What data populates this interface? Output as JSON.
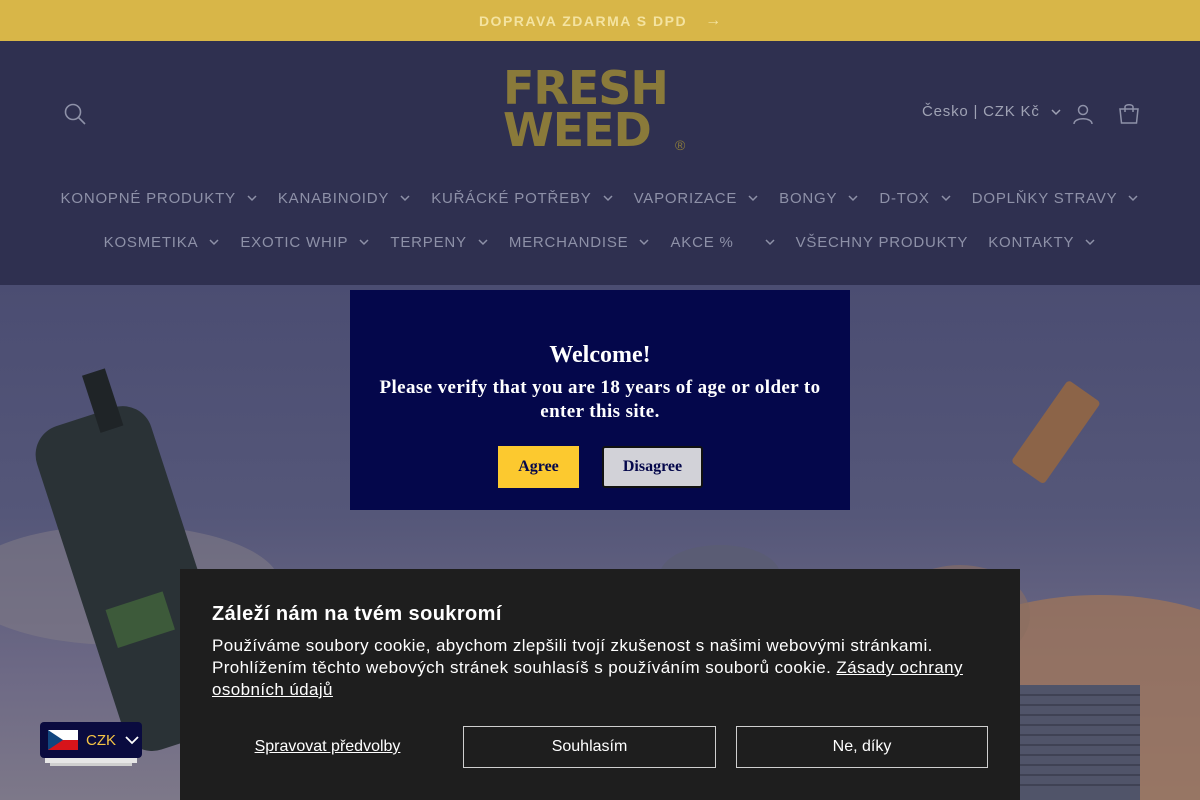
{
  "announcement": {
    "text": "DOPRAVA ZDARMA S DPD",
    "arrow": "→"
  },
  "header": {
    "logo_line1": "FRESH",
    "logo_line2": "WEED",
    "logo_reg": "®",
    "locale_label": "Česko | CZK Kč"
  },
  "nav": {
    "row1": [
      "KONOPNÉ PRODUKTY",
      "KANABINOIDY",
      "KUŘÁCKÉ POTŘEBY",
      "VAPORIZACE",
      "BONGY",
      "D-TOX",
      "DOPLŇKY STRAVY"
    ],
    "row2": [
      "KOSMETIKA",
      "EXOTIC WHIP",
      "TERPENY",
      "MERCHANDISE",
      "AKCE %",
      "VŠECHNY PRODUKTY",
      "KONTAKTY"
    ]
  },
  "age_gate": {
    "title": "Welcome!",
    "message": "Please verify that you are 18 years of age or older to enter this site.",
    "agree_label": "Agree",
    "disagree_label": "Disagree"
  },
  "cookie": {
    "title": "Záleží nám na tvém soukromí",
    "text": "Používáme soubory cookie, abychom zlepšili tvojí zkušenost s našimi webovými stránkami. Prohlížením těchto webových stránek souhlasíš s používáním souborů cookie. ",
    "link_label": "Zásady ochrany osobních údajů",
    "manage_label": "Spravovat předvolby",
    "accept_label": "Souhlasím",
    "decline_label": "Ne, díky"
  },
  "currency": {
    "code": "CZK"
  },
  "colors": {
    "announcement_bg": "#d8b648",
    "header_bg": "#2f3050",
    "modal_bg": "#04074b",
    "agree_bg": "#fcc92f",
    "cookie_bg": "#1e1e1e"
  }
}
